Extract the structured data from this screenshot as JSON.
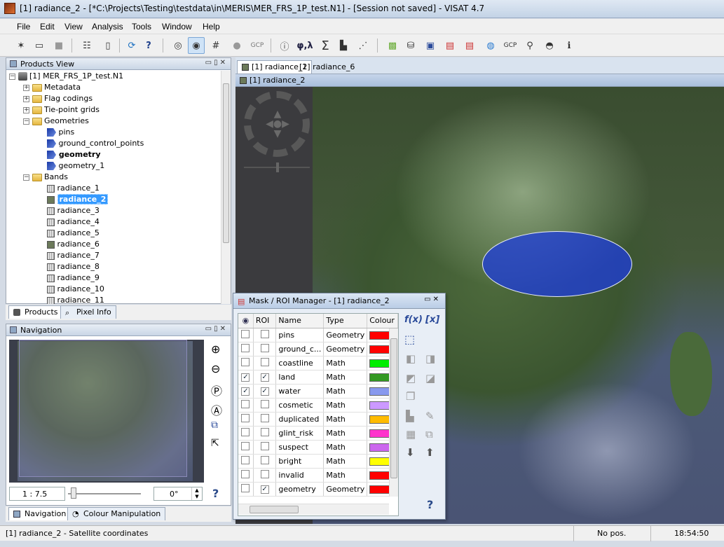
{
  "window": {
    "title": "[1] radiance_2 - [*C:\\Projects\\Testing\\testdata\\in\\MERIS\\MER_FRS_1P_test.N1] - [Session not saved] - VISAT 4.7"
  },
  "menu": [
    "File",
    "Edit",
    "View",
    "Analysis",
    "Tools",
    "Window",
    "Help"
  ],
  "toolbar": {
    "gcp1": "GCP",
    "phi_lambda": "φ,λ",
    "sigma": "Σ",
    "gcp2": "GCP"
  },
  "products_view": {
    "title": "Products View",
    "product": "[1] MER_FRS_1P_test.N1",
    "folders": [
      "Metadata",
      "Flag codings",
      "Tie-point grids",
      "Geometries",
      "Bands"
    ],
    "geometries": [
      "pins",
      "ground_control_points",
      "geometry",
      "geometry_1"
    ],
    "bands": [
      "radiance_1",
      "radiance_2",
      "radiance_3",
      "radiance_4",
      "radiance_5",
      "radiance_6",
      "radiance_7",
      "radiance_8",
      "radiance_9",
      "radiance_10",
      "radiance_11"
    ],
    "selected_band": "radiance_2",
    "tabs": {
      "products": "Products",
      "pixel_info": "Pixel Info"
    }
  },
  "navigation": {
    "title": "Navigation",
    "zoom_value": "1 : 7.5",
    "rotation_value": "0°",
    "help": "?",
    "tabs": {
      "navigation": "Navigation",
      "colour": "Colour Manipulation"
    }
  },
  "image_tabs": [
    "[1] radiance_2",
    "[1] radiance_6"
  ],
  "image_view": {
    "title": "[1] radiance_2"
  },
  "mask_manager": {
    "title": "Mask / ROI Manager - [1] radiance_2",
    "columns": {
      "roi": "ROI",
      "name": "Name",
      "type": "Type",
      "colour": "Colour"
    },
    "fx": "f(x)",
    "x": "[x]",
    "help": "?",
    "rows": [
      {
        "visible": false,
        "roi": false,
        "name": "pins",
        "type": "Geometry",
        "colour": "#ff0000"
      },
      {
        "visible": false,
        "roi": false,
        "name": "ground_c...",
        "type": "Geometry",
        "colour": "#ff0000"
      },
      {
        "visible": false,
        "roi": false,
        "name": "coastline",
        "type": "Math",
        "colour": "#00ee00"
      },
      {
        "visible": true,
        "roi": true,
        "name": "land",
        "type": "Math",
        "colour": "#339922"
      },
      {
        "visible": true,
        "roi": true,
        "name": "water",
        "type": "Math",
        "colour": "#8899ee"
      },
      {
        "visible": false,
        "roi": false,
        "name": "cosmetic",
        "type": "Math",
        "colour": "#cc99ff"
      },
      {
        "visible": false,
        "roi": false,
        "name": "duplicated",
        "type": "Math",
        "colour": "#ffbb00"
      },
      {
        "visible": false,
        "roi": false,
        "name": "glint_risk",
        "type": "Math",
        "colour": "#ff33cc"
      },
      {
        "visible": false,
        "roi": false,
        "name": "suspect",
        "type": "Math",
        "colour": "#cc66ee"
      },
      {
        "visible": false,
        "roi": false,
        "name": "bright",
        "type": "Math",
        "colour": "#ffff00"
      },
      {
        "visible": false,
        "roi": false,
        "name": "invalid",
        "type": "Math",
        "colour": "#ff0000"
      },
      {
        "visible": false,
        "roi": true,
        "name": "geometry",
        "type": "Geometry",
        "colour": "#ff0000"
      }
    ]
  },
  "status": {
    "left": "[1] radiance_2 - Satellite coordinates",
    "pos": "No pos.",
    "time": "18:54:50"
  }
}
